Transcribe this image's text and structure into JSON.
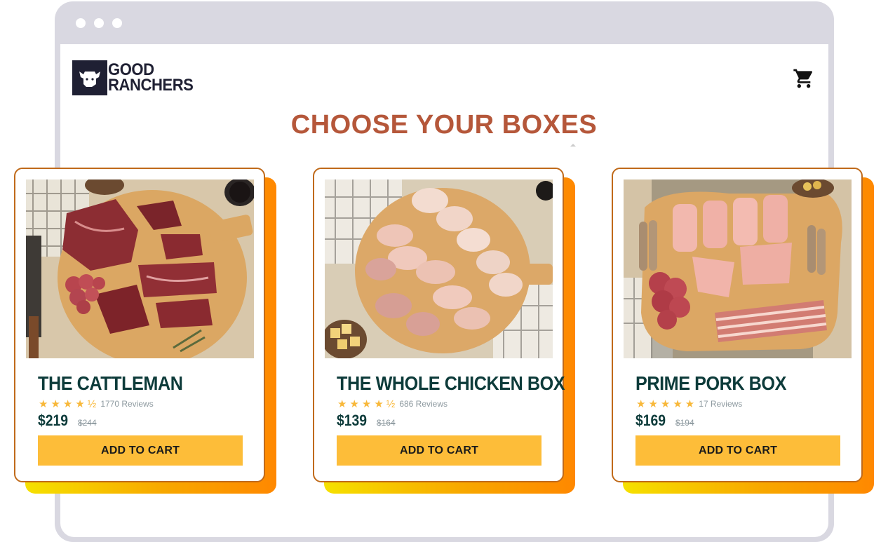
{
  "brand": {
    "line1": "GOOD",
    "line2": "RANCHERS"
  },
  "heading": "CHOOSE YOUR BOXES",
  "products": [
    {
      "title": "THE CATTLEMAN",
      "stars": "★★★★½",
      "reviews": "1770 Reviews",
      "price": "$219",
      "old_price": "$244",
      "cta": "ADD TO CART"
    },
    {
      "title": "THE WHOLE CHICKEN BOX",
      "stars": "★★★★½",
      "reviews": "686 Reviews",
      "price": "$139",
      "old_price": "$164",
      "cta": "ADD TO CART"
    },
    {
      "title": "PRIME PORK BOX",
      "stars": "★★★★★",
      "reviews": "17 Reviews",
      "price": "$169",
      "old_price": "$194",
      "cta": "ADD TO CART"
    }
  ],
  "colors": {
    "heading": "#b5573a",
    "title": "#0d3b3a",
    "button": "#fdbd39",
    "star": "#f8b83a",
    "card_border": "#c06a1a",
    "window_chrome": "#d9d8e1"
  }
}
